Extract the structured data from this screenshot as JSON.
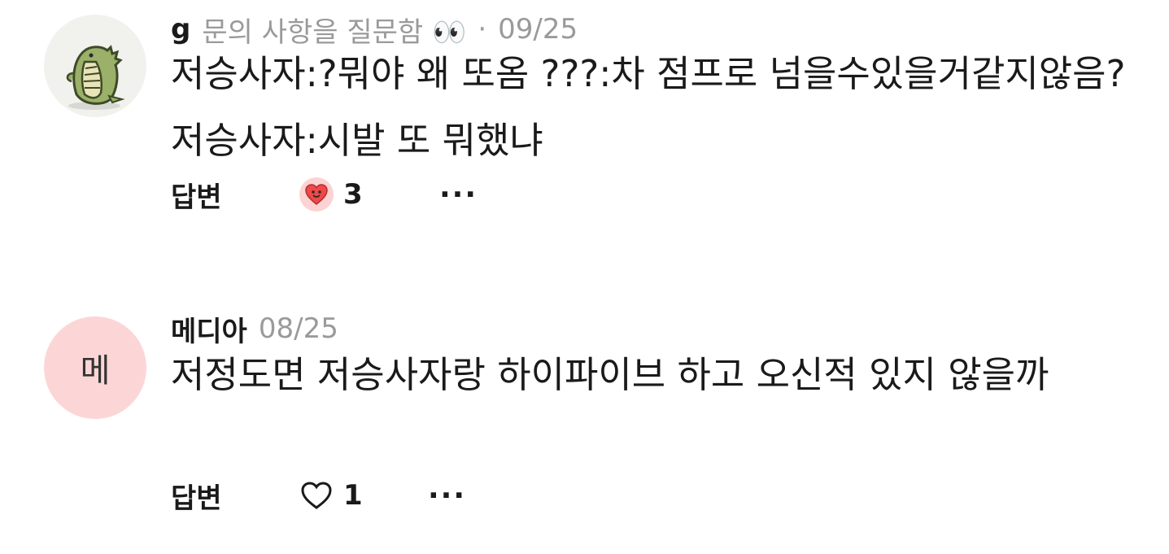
{
  "comments": [
    {
      "author": "g",
      "title": "문의 사항을 질문함 👀",
      "separator": "·",
      "date": "09/25",
      "text": "저승사자:?뭐야 왜 또옴 ???:차 점프로 넘을수있을거같지않음? 저승사자:시발 또 뭐했냐",
      "reply_label": "답변",
      "like_count": "3",
      "liked": true,
      "more_label": "···",
      "avatar_icon": "dinosaur-avatar-icon"
    },
    {
      "author": "메디아",
      "date": "08/25",
      "text": "저정도면 저승사자랑 하이파이브 하고 오신적 있지 않을까",
      "reply_label": "답변",
      "like_count": "1",
      "liked": false,
      "more_label": "···",
      "avatar_initial": "메",
      "avatar_color": "#fcd6d6"
    }
  ]
}
